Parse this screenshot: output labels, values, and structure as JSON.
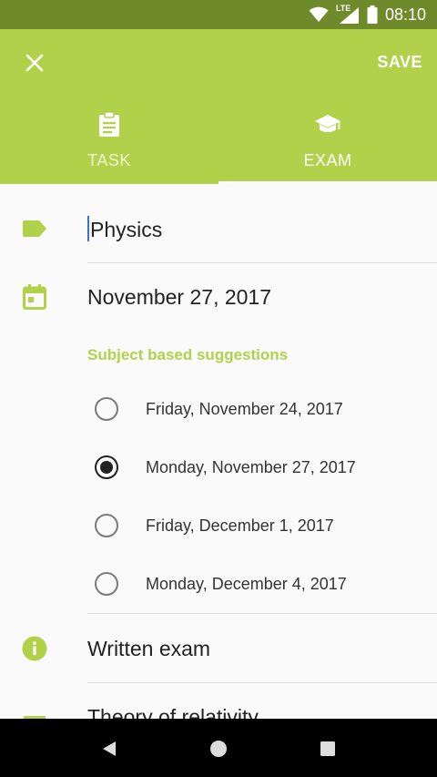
{
  "status_bar": {
    "time": "08:10",
    "network": "LTE",
    "icons": [
      "wifi-icon",
      "cell-signal-icon",
      "battery-icon"
    ]
  },
  "app_bar": {
    "close_icon": "close-icon",
    "save_label": "SAVE",
    "tabs": [
      {
        "label": "TASK",
        "icon": "clipboard-icon",
        "active": false
      },
      {
        "label": "EXAM",
        "icon": "graduation-cap-icon",
        "active": true
      }
    ]
  },
  "form": {
    "subject": {
      "value": "Physics",
      "icon": "label-tag-icon"
    },
    "date": {
      "value": "November 27, 2017",
      "icon": "calendar-icon"
    },
    "suggestions": {
      "title": "Subject based suggestions",
      "options": [
        {
          "label": "Friday, November 24, 2017",
          "selected": false
        },
        {
          "label": "Monday, November 27, 2017",
          "selected": true
        },
        {
          "label": "Friday, December 1, 2017",
          "selected": false
        },
        {
          "label": "Monday, December 4, 2017",
          "selected": false
        }
      ]
    },
    "exam_type": {
      "value": "Written exam",
      "icon": "info-icon"
    },
    "topic": {
      "value": "Theory of relativity",
      "icon": "notes-icon"
    }
  },
  "nav_bar": {
    "icons": [
      "back-icon",
      "home-icon",
      "recents-icon"
    ]
  },
  "colors": {
    "accent": "#b2d14a",
    "status_bar": "#6e8a2b",
    "text_primary": "#222222",
    "nav_bar": "#000000"
  }
}
